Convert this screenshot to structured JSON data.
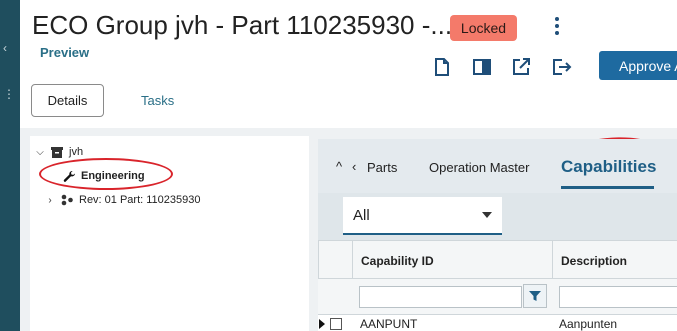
{
  "header": {
    "title": "ECO Group jvh - Part 110235930 -...",
    "status_badge": "Locked",
    "preview_label": "Preview",
    "approve_label": "Approve A"
  },
  "tabs": {
    "details": "Details",
    "tasks": "Tasks"
  },
  "tree": {
    "root_label": "jvh",
    "child_label": "Engineering",
    "rev_label": "Rev: 01 Part: 110235930"
  },
  "grid": {
    "tabs": {
      "parts": "Parts",
      "operation_master": "Operation Master",
      "capabilities": "Capabilities"
    },
    "filter_value": "All",
    "columns": [
      "Capability ID",
      "Description"
    ],
    "rows": [
      {
        "capability_id": "AANPUNT",
        "description": "Aanpunten"
      }
    ]
  },
  "colors": {
    "accent": "#1f5f86",
    "locked_badge": "#f47a6a",
    "annotation": "#d9242b",
    "rail": "#1f4e5e"
  },
  "icons": {
    "toolbar": [
      "document-icon",
      "panel-icon",
      "external-link-icon",
      "export-icon"
    ]
  }
}
